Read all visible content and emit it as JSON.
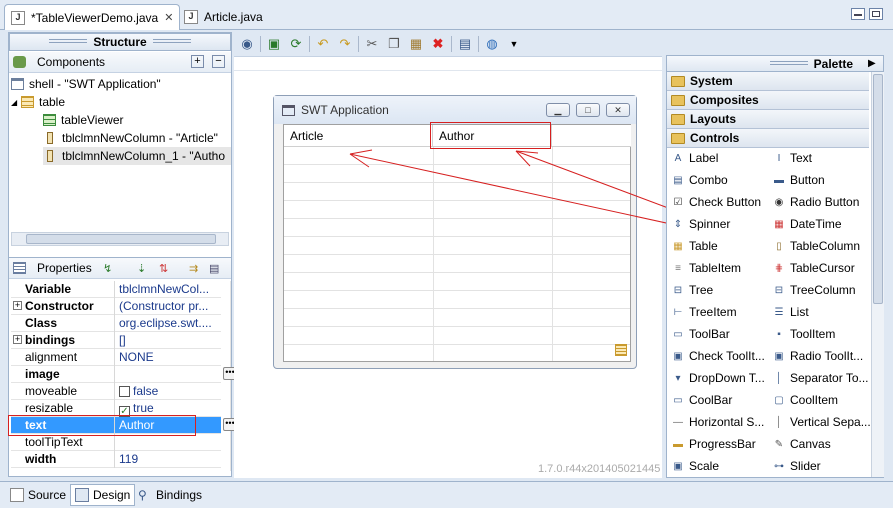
{
  "editor_tabs": [
    {
      "label": "*TableViewerDemo.java",
      "active": true
    },
    {
      "label": "Article.java",
      "active": false
    }
  ],
  "structure": {
    "title": "Structure",
    "components_label": "Components",
    "tree": [
      {
        "label": "shell - \"SWT Application\"",
        "icon": "shell-icon"
      },
      {
        "label": "table",
        "icon": "table-icon"
      },
      {
        "label": "tableViewer",
        "icon": "table-viewer-icon"
      },
      {
        "label": "tblclmnNewColumn - \"Article\"",
        "icon": "column-icon"
      },
      {
        "label": "tblclmnNewColumn_1 - \"Autho",
        "icon": "column-icon"
      }
    ]
  },
  "properties": {
    "title": "Properties",
    "rows": [
      {
        "name": "Variable",
        "value": "tblclmnNewCol...",
        "bold": true,
        "expand": false
      },
      {
        "name": "Constructor",
        "value": "(Constructor pr...",
        "bold": true,
        "expand": true
      },
      {
        "name": "Class",
        "value": "org.eclipse.swt....",
        "bold": true,
        "expand": false
      },
      {
        "name": "bindings",
        "value": "[]",
        "bold": true,
        "expand": true
      },
      {
        "name": "alignment",
        "value": "NONE",
        "bold": false,
        "expand": false
      },
      {
        "name": "image",
        "value": "",
        "bold": true,
        "expand": false
      },
      {
        "name": "moveable",
        "value": "false",
        "bold": false,
        "expand": false
      },
      {
        "name": "resizable",
        "value": "true",
        "bold": false,
        "expand": false
      },
      {
        "name": "text",
        "value": "Author",
        "bold": true,
        "expand": false
      },
      {
        "name": "toolTipText",
        "value": "",
        "bold": false,
        "expand": false
      },
      {
        "name": "width",
        "value": "119",
        "bold": true,
        "expand": false
      }
    ]
  },
  "design": {
    "shell_title": "SWT Application",
    "columns": [
      "Article",
      "Author"
    ],
    "version": "1.7.0.r44x201405021445"
  },
  "palette": {
    "title": "Palette",
    "categories": [
      "System",
      "Composites",
      "Layouts",
      "Controls"
    ],
    "items": [
      [
        "Label",
        "Text"
      ],
      [
        "Combo",
        "Button"
      ],
      [
        "Check Button",
        "Radio Button"
      ],
      [
        "Spinner",
        "DateTime"
      ],
      [
        "Table",
        "TableColumn"
      ],
      [
        "TableItem",
        "TableCursor"
      ],
      [
        "Tree",
        "TreeColumn"
      ],
      [
        "TreeItem",
        "List"
      ],
      [
        "ToolBar",
        "ToolItem"
      ],
      [
        "Check ToolIt...",
        "Radio ToolIt..."
      ],
      [
        "DropDown T...",
        "Separator To..."
      ],
      [
        "CoolBar",
        "CoolItem"
      ],
      [
        "Horizontal S...",
        "Vertical Sepa..."
      ],
      [
        "ProgressBar",
        "Canvas"
      ],
      [
        "Scale",
        "Slider"
      ]
    ]
  },
  "bottom_tabs": [
    "Source",
    "Design",
    "Bindings"
  ],
  "colors": {
    "highlight": "#d62020",
    "selection": "#3399ff",
    "arrow": "#d62020"
  }
}
